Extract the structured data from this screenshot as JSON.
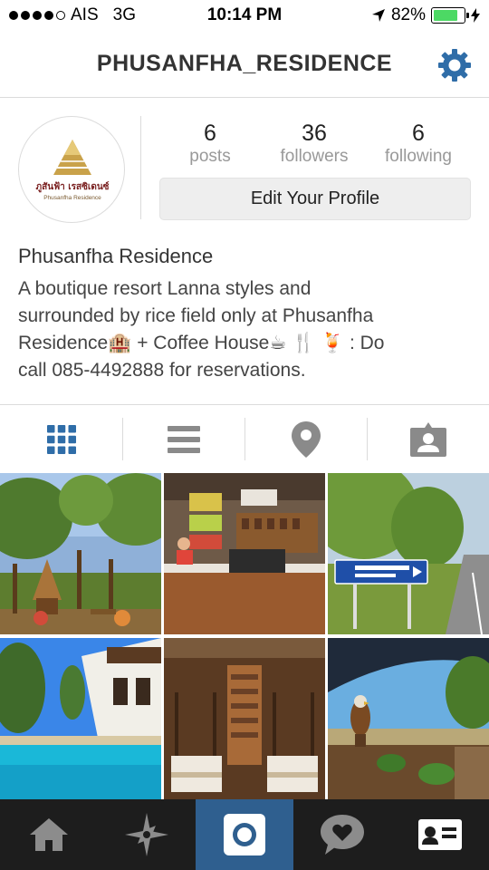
{
  "status_bar": {
    "carrier": "AIS",
    "network": "3G",
    "time": "10:14 PM",
    "battery": "82%",
    "battery_level": 0.82,
    "signal_bars_filled": 4,
    "signal_bars_total": 5
  },
  "header": {
    "username": "PHUSANFHA_RESIDENCE",
    "settings_icon": "gear-icon"
  },
  "profile": {
    "avatar_brand": "ภูสันฟ้า เรสซิเดนซ์",
    "avatar_brand_sub": "Phusanfha Residence",
    "stats": [
      {
        "count": "6",
        "label": "posts"
      },
      {
        "count": "36",
        "label": "followers"
      },
      {
        "count": "6",
        "label": "following"
      }
    ],
    "edit_button": "Edit Your Profile",
    "display_name": "Phusanfha Residence",
    "bio_lines": [
      "A boutique resort Lanna styles and",
      "surrounded by rice field only at Phusanfha",
      "Residence🏨 + Coffee House☕ 🍴 🍹 : Do",
      "call 085-4492888 for reservations."
    ]
  },
  "view_tabs": [
    "grid-icon",
    "list-icon",
    "location-pin-icon",
    "tagged-photos-icon"
  ],
  "photos": [
    {
      "subject": "garden-hut"
    },
    {
      "subject": "coffee-counter"
    },
    {
      "subject": "road-sign"
    },
    {
      "subject": "pool-villa"
    },
    {
      "subject": "bedroom"
    },
    {
      "subject": "eagle-terrace"
    }
  ],
  "tab_bar": [
    "home-icon",
    "explore-icon",
    "camera-icon",
    "activity-icon",
    "profile-icon"
  ],
  "colors": {
    "accent_blue": "#2f6da8",
    "tab_active": "#2f5f8f",
    "tab_bar_bg": "#1d1d1d",
    "battery_green": "#4cd964"
  }
}
